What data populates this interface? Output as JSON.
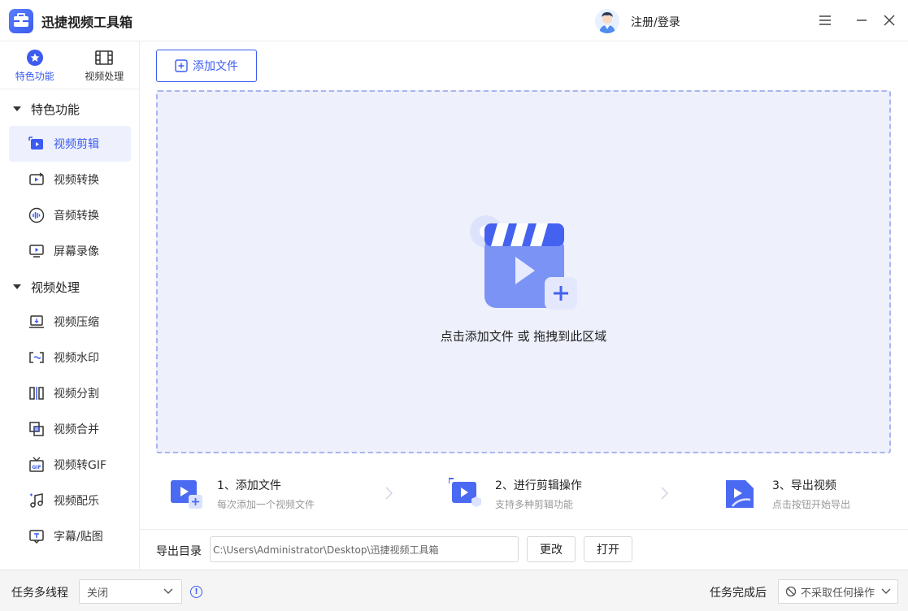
{
  "app": {
    "title": "迅捷视频工具箱",
    "login": "注册/登录"
  },
  "sidebar": {
    "tabs": [
      {
        "label": "特色功能",
        "icon": "star-circle-icon"
      },
      {
        "label": "视频处理",
        "icon": "film-icon"
      }
    ],
    "groups": [
      {
        "label": "特色功能",
        "items": [
          {
            "label": "视频剪辑",
            "icon": "video-edit-icon"
          },
          {
            "label": "视频转换",
            "icon": "video-convert-icon"
          },
          {
            "label": "音频转换",
            "icon": "audio-wave-icon"
          },
          {
            "label": "屏幕录像",
            "icon": "screen-record-icon"
          }
        ]
      },
      {
        "label": "视频处理",
        "items": [
          {
            "label": "视频压缩",
            "icon": "compress-icon"
          },
          {
            "label": "视频水印",
            "icon": "watermark-icon"
          },
          {
            "label": "视频分割",
            "icon": "split-icon"
          },
          {
            "label": "视频合并",
            "icon": "merge-icon"
          },
          {
            "label": "视频转GIF",
            "icon": "gif-icon"
          },
          {
            "label": "视频配乐",
            "icon": "music-note-icon"
          },
          {
            "label": "字幕/贴图",
            "icon": "subtitle-icon"
          }
        ]
      }
    ]
  },
  "main": {
    "add_button": "添加文件",
    "drop_text": "点击添加文件 或 拖拽到此区域",
    "steps": [
      {
        "title": "1、添加文件",
        "desc": "每次添加一个视频文件"
      },
      {
        "title": "2、进行剪辑操作",
        "desc": "支持多种剪辑功能"
      },
      {
        "title": "3、导出视频",
        "desc": "点击按钮开始导出"
      }
    ],
    "export": {
      "label": "导出目录",
      "path": "C:\\Users\\Administrator\\Desktop\\迅捷视频工具箱",
      "change": "更改",
      "open": "打开"
    }
  },
  "bottom": {
    "multithread_label": "任务多线程",
    "multithread_value": "关闭",
    "after_label": "任务完成后",
    "after_value": "不采取任何操作"
  },
  "colors": {
    "accent": "#3c5bf0",
    "active_bg": "#eef1fd",
    "drop_bg": "#eef0fc"
  }
}
